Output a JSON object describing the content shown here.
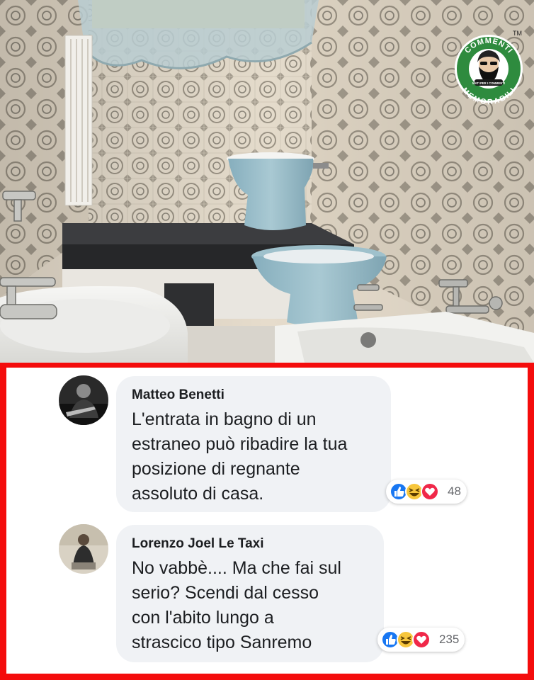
{
  "logo": {
    "top_text": "COMMENTI",
    "bottom_text": "MEMORABILI",
    "tagline": "MATI PER I COMMENTI",
    "trademark": "TM",
    "ring_color": "#2e8b3e"
  },
  "comments": [
    {
      "author": "Matteo Benetti",
      "lines": [
        "L'entrata in bagno di un",
        "estraneo può ribadire la tua",
        "posizione di regnante",
        "assoluto di casa."
      ],
      "reactions": [
        "like-icon",
        "haha-icon",
        "love-icon"
      ],
      "reaction_count": "48"
    },
    {
      "author": "Lorenzo Joel Le Taxi",
      "lines": [
        "No vabbè.... Ma che fai sul",
        "serio? Scendi dal cesso",
        "con l'abito lungo a",
        "strascico tipo Sanremo"
      ],
      "reactions": [
        "like-icon",
        "haha-icon",
        "love-icon"
      ],
      "reaction_count": "235"
    }
  ],
  "colors": {
    "frame": "#f40c0c",
    "bubble": "#f0f2f5",
    "like": "#1877f2",
    "haha": "#f7c63c",
    "love": "#f02849"
  }
}
